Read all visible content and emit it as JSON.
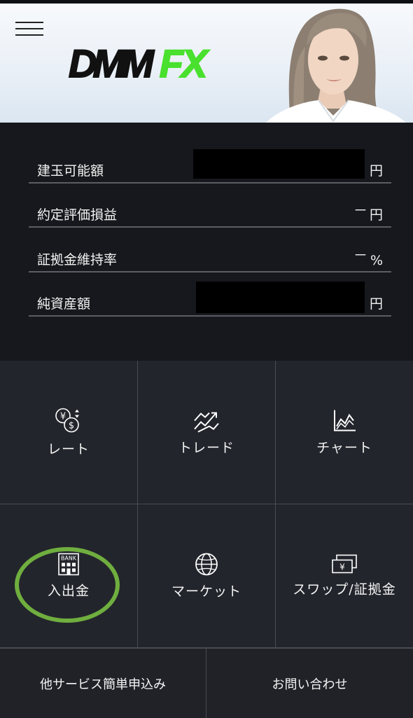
{
  "header": {
    "menu_icon": "hamburger-menu-icon",
    "logo": {
      "part1": "DMM",
      "part2": "FX",
      "accent_color": "#49e02e"
    }
  },
  "account": {
    "rows": [
      {
        "label": "建玉可能額",
        "value": "",
        "unit": "円"
      },
      {
        "label": "約定評価損益",
        "value": "－",
        "unit": "円"
      },
      {
        "label": "証拠金維持率",
        "value": "－",
        "unit": "%"
      },
      {
        "label": "純資産額",
        "value": "",
        "unit": "円"
      }
    ]
  },
  "menu": {
    "items": [
      {
        "label": "レート",
        "icon": "currency-rate-icon"
      },
      {
        "label": "トレード",
        "icon": "trade-arrows-icon"
      },
      {
        "label": "チャート",
        "icon": "chart-icon"
      },
      {
        "label": "入出金",
        "icon": "bank-icon"
      },
      {
        "label": "マーケット",
        "icon": "globe-icon"
      },
      {
        "label": "スワップ/証拠金",
        "icon": "yen-notes-icon"
      }
    ],
    "highlight_color": "#6fae3f"
  },
  "bottom": {
    "left_label": "他サービス簡単申込み",
    "right_label": "お問い合わせ"
  }
}
